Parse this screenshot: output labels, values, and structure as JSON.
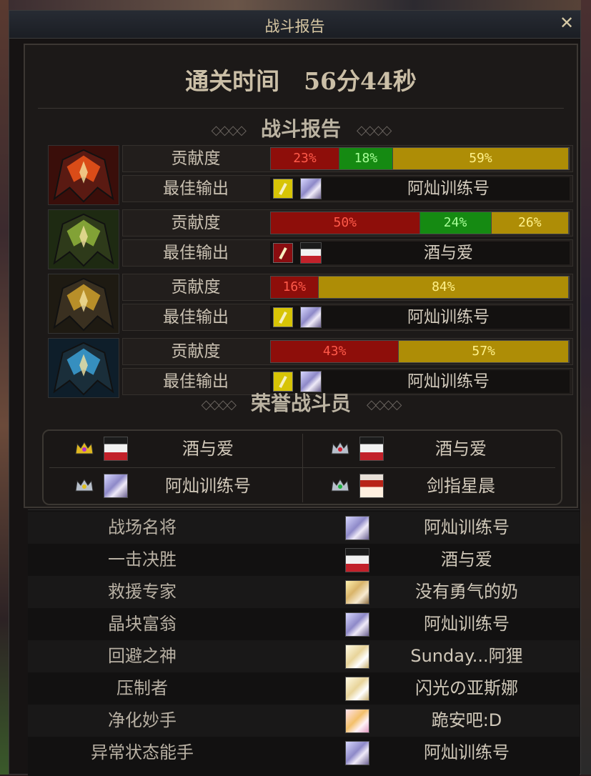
{
  "window": {
    "title": "战斗报告",
    "close_label": "✕"
  },
  "clear_time": {
    "label": "通关时间",
    "value": "56分44秒"
  },
  "report_section": {
    "title": "战斗报告"
  },
  "labels": {
    "contribution": "贡献度",
    "best_output": "最佳输出"
  },
  "bosses": [
    {
      "portrait_icon": "red-boss-portrait-icon",
      "contribution": [
        {
          "pct": "23%",
          "color": "red",
          "value": 23
        },
        {
          "pct": "18%",
          "color": "green",
          "value": 18
        },
        {
          "pct": "59%",
          "color": "yellow",
          "value": 59
        }
      ],
      "weapon_color": "gold",
      "avatar": "silver",
      "best_player": "阿灿训练号"
    },
    {
      "portrait_icon": "green-boss-portrait-icon",
      "contribution": [
        {
          "pct": "50%",
          "color": "red",
          "value": 50
        },
        {
          "pct": "24%",
          "color": "green",
          "value": 24
        },
        {
          "pct": "26%",
          "color": "yellow",
          "value": 26
        }
      ],
      "weapon_color": "crimson",
      "avatar": "redwhite",
      "best_player": "酒与爱"
    },
    {
      "portrait_icon": "gold-boss-portrait-icon",
      "contribution": [
        {
          "pct": "16%",
          "color": "red",
          "value": 16
        },
        {
          "pct": "84%",
          "color": "yellow",
          "value": 84
        }
      ],
      "weapon_color": "gold",
      "avatar": "silver",
      "best_player": "阿灿训练号"
    },
    {
      "portrait_icon": "blue-boss-portrait-icon",
      "contribution": [
        {
          "pct": "43%",
          "color": "red",
          "value": 43
        },
        {
          "pct": "57%",
          "color": "yellow",
          "value": 57
        }
      ],
      "weapon_color": "gold",
      "avatar": "silver",
      "best_player": "阿灿训练号"
    }
  ],
  "honor_section": {
    "title": "荣誉战斗员",
    "members": [
      {
        "name": "酒与爱",
        "crown": "gold-crown-icon",
        "gem": "#b030d0",
        "avatar": "redwhite"
      },
      {
        "name": "酒与爱",
        "crown": "silver-crown-icon",
        "gem": "#d02030",
        "avatar": "redwhite"
      },
      {
        "name": "阿灿训练号",
        "crown": "silver-crown-icon",
        "gem": "#e0c020",
        "avatar": "silver"
      },
      {
        "name": "剑指星晨",
        "crown": "silver-crown-icon",
        "gem": "#20b040",
        "avatar": "redhair"
      }
    ]
  },
  "awards": [
    {
      "title": "战场名将",
      "player": "阿灿训练号",
      "avatar": "silver"
    },
    {
      "title": "一击决胜",
      "player": "酒与爱",
      "avatar": "redwhite"
    },
    {
      "title": "救援专家",
      "player": "没有勇气的奶",
      "avatar": "blonde"
    },
    {
      "title": "晶块富翁",
      "player": "阿灿训练号",
      "avatar": "silver"
    },
    {
      "title": "回避之神",
      "player": "Sunday...阿狸",
      "avatar": "pale"
    },
    {
      "title": "压制者",
      "player": "闪光の亚斯娜",
      "avatar": "pale"
    },
    {
      "title": "净化妙手",
      "player": "跪安吧:D",
      "avatar": "pinky"
    },
    {
      "title": "异常状态能手",
      "player": "阿灿训练号",
      "avatar": "silver"
    }
  ],
  "colors": {
    "bar_red": "#8e0e0a",
    "bar_green": "#158a12",
    "bar_yellow": "#ae8d06",
    "text_gold": "#d8c8a4",
    "panel_bg": "#1c1918"
  }
}
